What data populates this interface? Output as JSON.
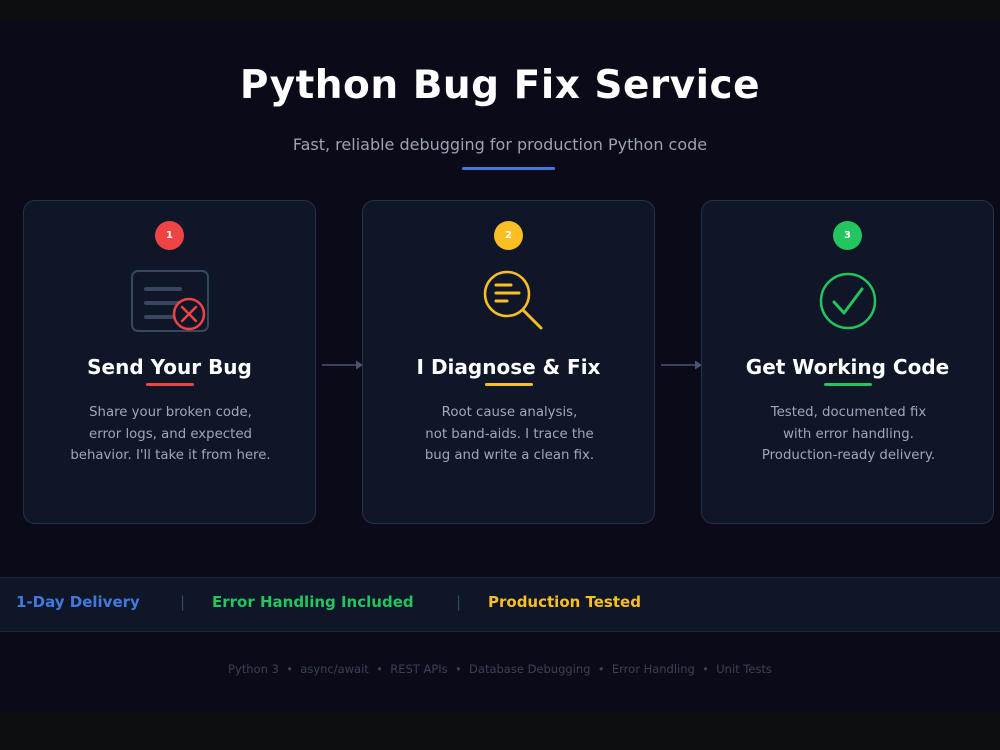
{
  "header": {
    "title": "Python Bug Fix Service",
    "subtitle": "Fast, reliable debugging for production Python code"
  },
  "colors": {
    "accent": "#4279e0",
    "red": "#ef4444",
    "yellow": "#fbbf24",
    "green": "#22c55e"
  },
  "steps": [
    {
      "number": "1",
      "title": "Send Your Bug",
      "icon": "document-error-icon",
      "color": "#ef4444",
      "desc": [
        "Share your broken code,",
        "error logs, and expected",
        "behavior. I'll take it from here."
      ]
    },
    {
      "number": "2",
      "title": "I Diagnose & Fix",
      "icon": "magnifier-icon",
      "color": "#fbbf24",
      "desc": [
        "Root cause analysis,",
        "not band-aids. I trace the",
        "bug and write a clean fix."
      ]
    },
    {
      "number": "3",
      "title": "Get Working Code",
      "icon": "check-circle-icon",
      "color": "#22c55e",
      "desc": [
        "Tested, documented fix",
        "with error handling.",
        "Production-ready delivery."
      ]
    }
  ],
  "features": [
    {
      "label": "1-Day Delivery",
      "color": "#4279e0"
    },
    {
      "label": "Error Handling Included",
      "color": "#22c55e"
    },
    {
      "label": "Production Tested",
      "color": "#fbbf24"
    }
  ],
  "separator": "|",
  "footer": "Python 3  •  async/await  •  REST APIs  •  Database Debugging  •  Error Handling  •  Unit Tests"
}
